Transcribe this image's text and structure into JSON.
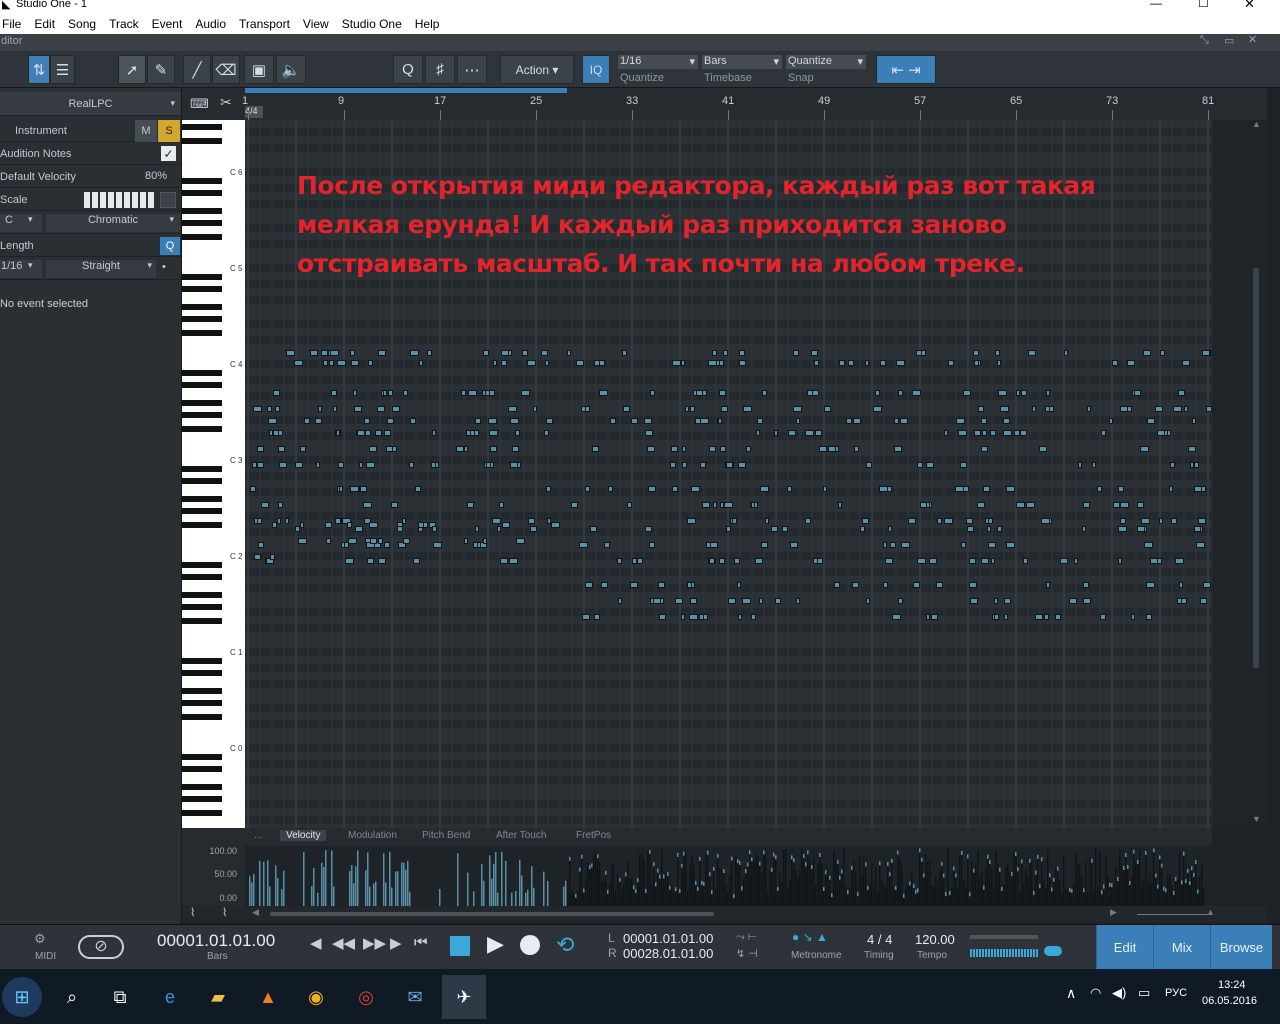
{
  "window": {
    "title": "Studio One - 1"
  },
  "menu": [
    "File",
    "Edit",
    "Song",
    "Track",
    "Event",
    "Audio",
    "Transport",
    "View",
    "Studio One",
    "Help"
  ],
  "editor_title": "ditor",
  "toolbar": {
    "action_label": "Action",
    "iq_label": "IQ",
    "quantize": {
      "value": "1/16",
      "label": "Quantize"
    },
    "timebase": {
      "value": "Bars",
      "label": "Timebase"
    },
    "snap": {
      "value": "Quantize",
      "label": "Snap"
    }
  },
  "inspector": {
    "instrument_name": "RealLPC",
    "instrument_label": "Instrument",
    "mute": "M",
    "solo": "S",
    "audition_notes": "Audition Notes",
    "default_velocity_label": "Default Velocity",
    "default_velocity_value": "80%",
    "scale_label": "Scale",
    "scale_root": "C",
    "scale_type": "Chromatic",
    "length_label": "Length",
    "length_q": "Q",
    "length_value": "1/16",
    "length_mode": "Straight",
    "status": "No event selected"
  },
  "ruler": {
    "time_signature": "4/4",
    "bars": [
      "1",
      "9",
      "17",
      "25",
      "33",
      "41",
      "49",
      "57",
      "65",
      "73",
      "81"
    ]
  },
  "keyboard_labels": [
    "C 6",
    "C 5",
    "C 4",
    "C 3",
    "C 2",
    "C 1",
    "C 0"
  ],
  "annotation": {
    "lines": [
      "После открытия миди редактора, каждый раз вот такая",
      "мелкая ерунда! И каждый раз приходится заново",
      "отстраивать масштаб. И так почти на любом треке."
    ]
  },
  "lane": {
    "tabs": [
      "...",
      "Velocity",
      "Modulation",
      "Pitch Bend",
      "After Touch",
      "FretPos"
    ],
    "active": "Velocity",
    "scale": [
      "100.00",
      "50.00",
      "0.00"
    ]
  },
  "transport": {
    "midi_label": "MIDI",
    "position": "00001.01.01.00",
    "position_unit": "Bars",
    "loop_left": "00001.01.01.00",
    "loop_right": "00028.01.01.00",
    "L": "L",
    "R": "R",
    "metronome_label": "Metronome",
    "timing_value": "4 / 4",
    "timing_label": "Timing",
    "tempo_value": "120.00",
    "tempo_label": "Tempo",
    "edit": "Edit",
    "mix": "Mix",
    "browse": "Browse"
  },
  "taskbar": {
    "time": "13:24",
    "date": "06.05.2016",
    "lang": "РУС"
  },
  "colors": {
    "accent": "#3a7fb8",
    "annotation": "#e2242c",
    "note": "#5a8fa8"
  }
}
